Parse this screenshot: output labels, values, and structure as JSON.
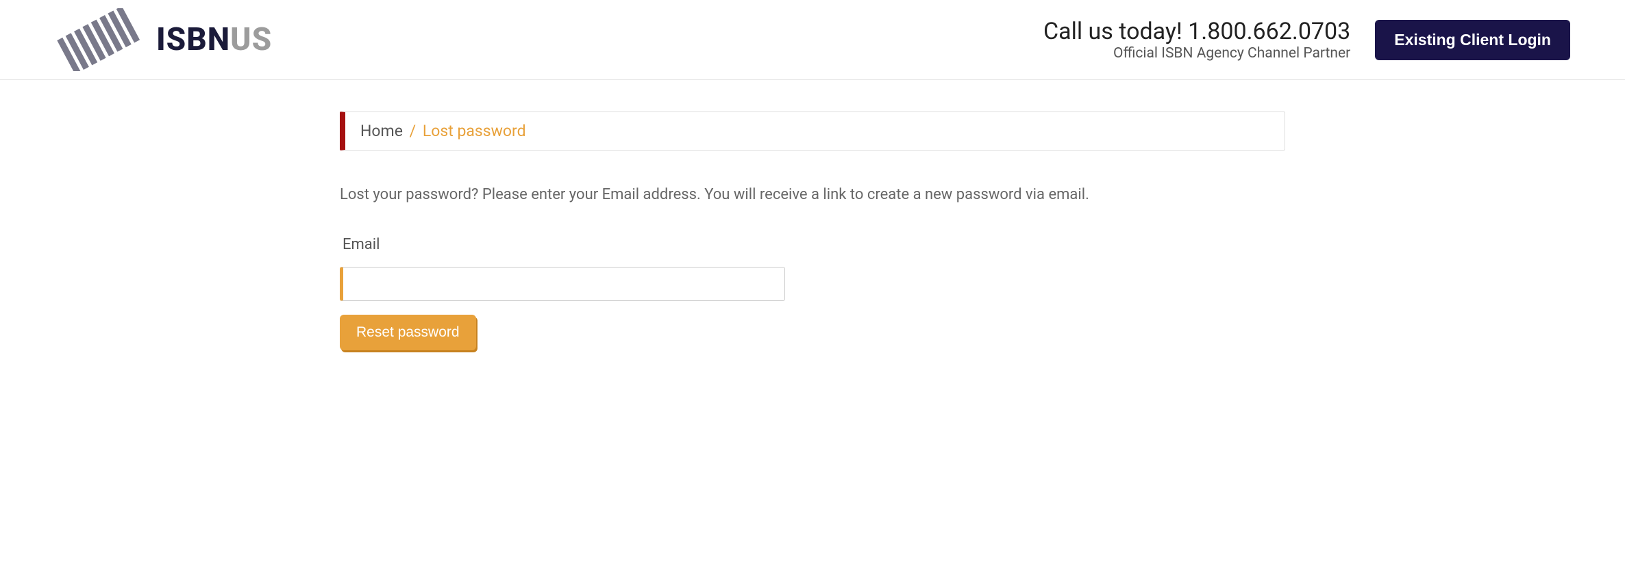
{
  "header": {
    "brand_dark": "ISBN",
    "brand_gray": "US",
    "call_line": "Call us today! 1.800.662.0703",
    "call_sub": "Official ISBN Agency Channel Partner",
    "login_label": "Existing Client Login"
  },
  "breadcrumb": {
    "home": "Home",
    "sep": "/",
    "current": "Lost password"
  },
  "main": {
    "instructions": "Lost your password? Please enter your Email address. You will receive a link to create a new password via email.",
    "email_label": "Email",
    "email_value": "",
    "submit_label": "Reset password"
  }
}
